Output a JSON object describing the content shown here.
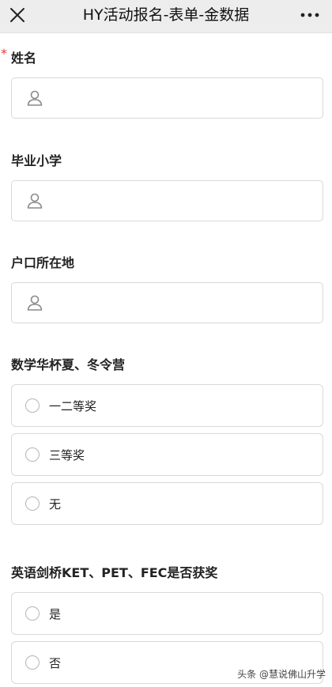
{
  "header": {
    "title": "HY活动报名-表单-金数据",
    "close_icon": "close-icon",
    "more_icon": "more-dots-icon"
  },
  "form": {
    "required_mark": "*",
    "fields": [
      {
        "label": "姓名",
        "type": "text",
        "required": true,
        "icon": "person-icon"
      },
      {
        "label": "毕业小学",
        "type": "text",
        "required": false,
        "icon": "person-icon"
      },
      {
        "label": "户口所在地",
        "type": "text",
        "required": false,
        "icon": "person-icon"
      },
      {
        "label": "数学华杯夏、冬令营",
        "type": "radio",
        "options": [
          "一二等奖",
          "三等奖",
          "无"
        ]
      },
      {
        "label": "英语剑桥KET、PET、FEC是否获奖",
        "type": "radio",
        "options": [
          "是",
          "否"
        ]
      }
    ]
  },
  "watermark": "头条 @慧说佛山升学",
  "colors": {
    "header_bg": "#ededed",
    "required": "#e53935",
    "border": "#d9d9d9"
  }
}
